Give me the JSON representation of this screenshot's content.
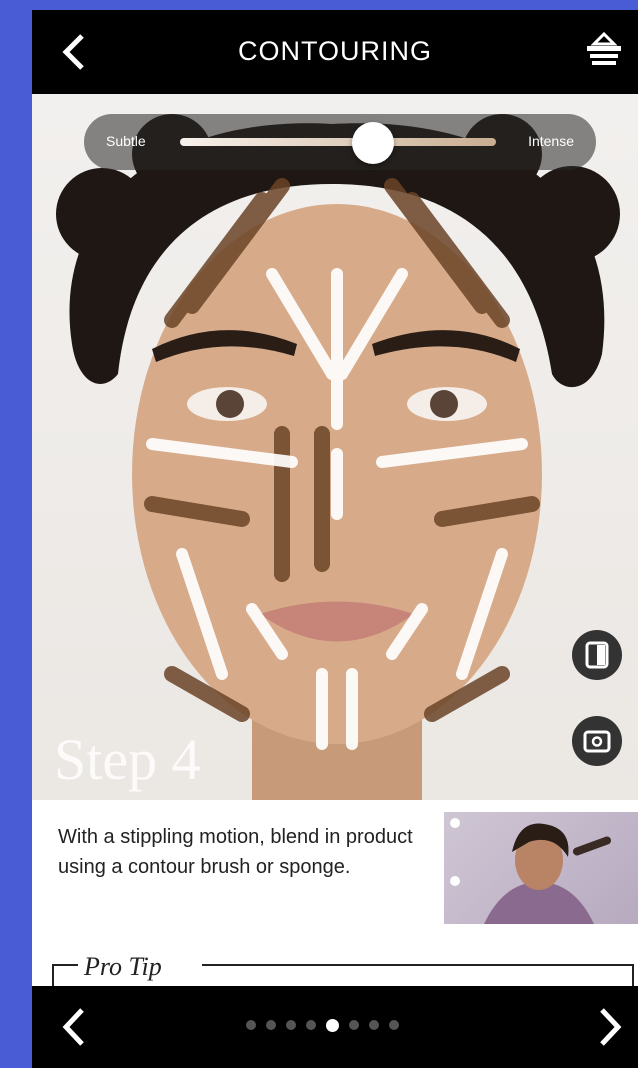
{
  "header": {
    "title": "CONTOURING",
    "back_icon": "chevron-left-icon",
    "basket_icon": "basket-icon"
  },
  "slider": {
    "left_label": "Subtle",
    "right_label": "Intense",
    "value": 0.61
  },
  "photo": {
    "step_label": "Step 4",
    "compare_icon": "compare-icon",
    "camera_icon": "camera-icon"
  },
  "instructions": {
    "text": "With a stippling motion, blend in product using a contour brush or sponge."
  },
  "pro_tip": {
    "label": "Pro Tip"
  },
  "footer": {
    "prev_icon": "chevron-left-icon",
    "next_icon": "chevron-right-icon",
    "page_count": 8,
    "current_page": 5
  },
  "colors": {
    "background": "#4a5bd6",
    "bar": "#000000",
    "contour_dark": "#6b4427",
    "highlight": "#ffffff"
  }
}
